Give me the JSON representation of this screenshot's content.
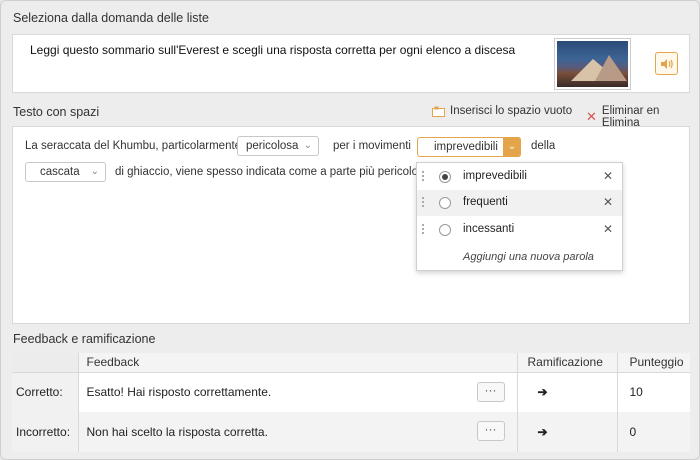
{
  "section1": {
    "title": "Seleziona dalla domanda delle liste"
  },
  "prompt": {
    "text": "Leggi questo sommario sull'Everest e scegli una risposta corretta per ogni elenco a discesa",
    "image_icon": "mountain-thumbnail",
    "audio_icon": "speaker-icon"
  },
  "section2": {
    "title": "Testo con spazi"
  },
  "toolbar": {
    "insert_gap_label": "Inserisci lo spazio vuoto",
    "delete_label": "Eliminar en Elimina",
    "accent_color": "#e3a44a",
    "delete_icon_color": "#d9534f"
  },
  "cloze": {
    "text1": "La seraccata del Khumbu, particolarmente",
    "dropdown1": "pericolosa",
    "text2": "per i movimenti",
    "dropdown2": "imprevedibili",
    "text3": "della",
    "dropdown3": "cascata",
    "text4": "di ghiaccio, viene spesso indicata come a parte più pericolosa"
  },
  "menu": {
    "options": [
      {
        "label": "imprevedibili",
        "selected": true
      },
      {
        "label": "frequenti",
        "selected": false
      },
      {
        "label": "incessanti",
        "selected": false
      }
    ],
    "add_label": "Aggiungi una nuova parola"
  },
  "section3": {
    "title": "Feedback e ramificazione"
  },
  "feedback_table": {
    "headers": [
      "",
      "Feedback",
      "Ramificazione",
      "Punteggio"
    ],
    "rows": [
      {
        "label": "Corretto:",
        "feedback": "Esatto! Hai risposto correttamente.",
        "more": "···",
        "branch_icon": "arrow-right",
        "score": "10"
      },
      {
        "label": "Incorretto:",
        "feedback": "Non hai scelto la risposta corretta.",
        "more": "···",
        "branch_icon": "arrow-right",
        "score": "0"
      }
    ]
  }
}
